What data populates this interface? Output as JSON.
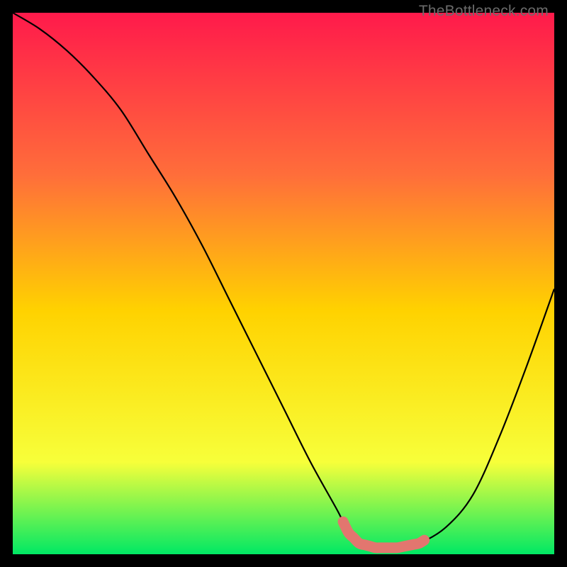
{
  "attribution": "TheBottleneck.com",
  "colors": {
    "gradient_top": "#ff1a4b",
    "gradient_mid_upper": "#ff6e3a",
    "gradient_mid": "#ffd200",
    "gradient_mid_lower": "#f7ff3a",
    "gradient_bottom": "#00e864",
    "curve": "#000000",
    "highlight": "#e2766f",
    "frame": "#000000"
  },
  "chart_data": {
    "type": "line",
    "title": "",
    "xlabel": "",
    "ylabel": "",
    "xlim": [
      0,
      100
    ],
    "ylim": [
      0,
      100
    ],
    "grid": false,
    "legend": false,
    "series": [
      {
        "name": "bottleneck-curve",
        "x": [
          0,
          5,
          10,
          15,
          20,
          25,
          30,
          35,
          40,
          45,
          50,
          55,
          60,
          62,
          64,
          67,
          71,
          75,
          80,
          85,
          90,
          95,
          100
        ],
        "values": [
          100,
          97,
          93,
          88,
          82,
          74,
          66,
          57,
          47,
          37,
          27,
          17,
          8,
          4,
          2,
          1.2,
          1.2,
          2,
          5,
          11,
          22,
          35,
          49
        ]
      }
    ],
    "highlight_segment": {
      "series": "bottleneck-curve",
      "x_start": 61,
      "x_end": 76,
      "style": "thick-rounded",
      "color_key": "highlight"
    },
    "annotations": []
  }
}
